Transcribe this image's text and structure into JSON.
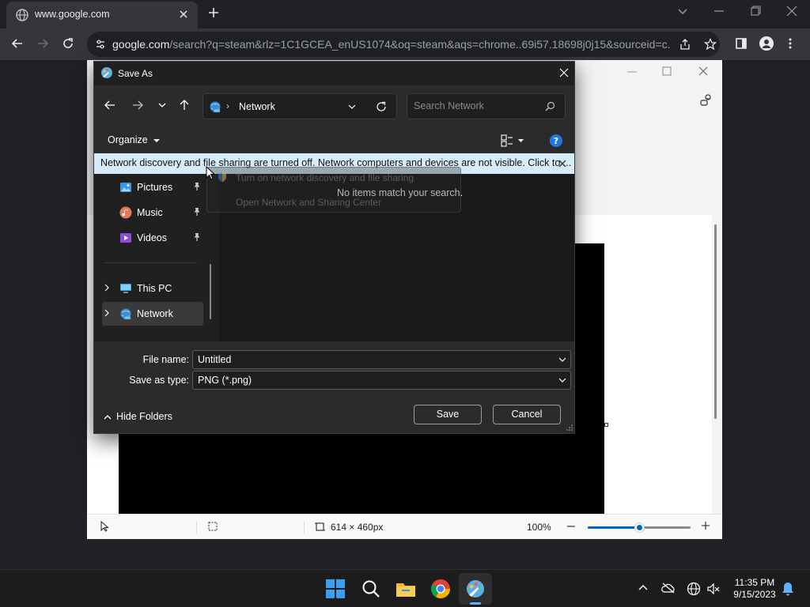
{
  "browser": {
    "tab_title": "www.google.com",
    "url_host": "google.com",
    "url_path": "/search?q=steam&rlz=1C1GCEA_enUS1074&oq=steam&aqs=chrome..69i57.18698j0j15&sourceid=c..."
  },
  "paint": {
    "canvas_size": "614 × 460px",
    "zoom": "100%",
    "zoom_fraction": 0.5
  },
  "dialog": {
    "title": "Save As",
    "address": "Network",
    "search_placeholder": "Search Network",
    "organize_label": "Organize",
    "infobar_text": "Network discovery and file sharing are turned off. Network computers and devices are not visible. Click to ...",
    "context_menu": [
      "Turn on network discovery and file sharing",
      "Open Network and Sharing Center"
    ],
    "nav_items": [
      {
        "label": "Pictures",
        "pinned": true
      },
      {
        "label": "Music",
        "pinned": true
      },
      {
        "label": "Videos",
        "pinned": true
      },
      {
        "label": "This PC",
        "pinned": false
      },
      {
        "label": "Network",
        "pinned": false
      }
    ],
    "empty_message": "No items match your search.",
    "file_name_label": "File name:",
    "file_name_value": "Untitled",
    "save_type_label": "Save as type:",
    "save_type_value": "PNG (*.png)",
    "save_button": "Save",
    "cancel_button": "Cancel",
    "hide_folders": "Hide Folders"
  },
  "taskbar": {
    "time": "11:35 PM",
    "date": "9/15/2023"
  },
  "colors": {
    "accent": "#0067c0",
    "infobar": "#d6ecfb",
    "dialog_bg": "#202020"
  }
}
